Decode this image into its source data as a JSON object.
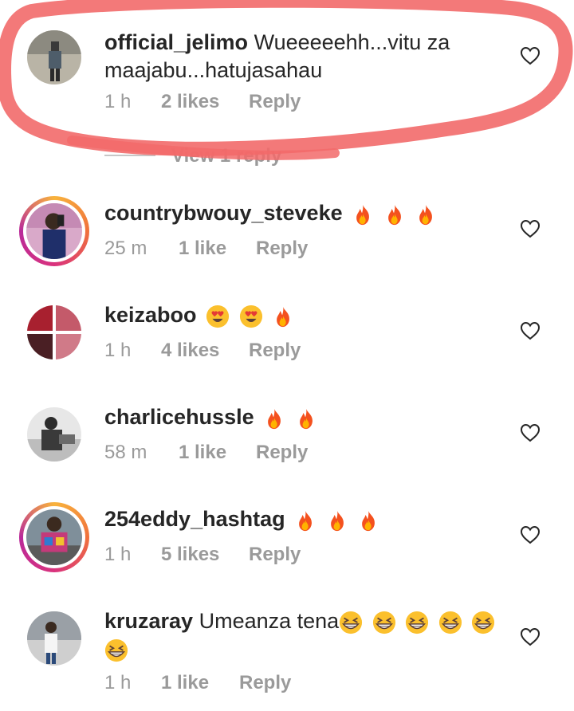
{
  "comments": [
    {
      "username": "official_jelimo",
      "text": "Wueeeeehh...vitu za maajabu...hatujasahau",
      "time": "1 h",
      "likes": "2 likes",
      "reply": "Reply",
      "view_replies": "View 1 reply",
      "emojis": []
    },
    {
      "username": "countrybwouy_steveke",
      "text": "",
      "time": "25 m",
      "likes": "1 like",
      "reply": "Reply",
      "emojis": [
        "fire",
        "fire",
        "fire"
      ]
    },
    {
      "username": "keizaboo",
      "text": "",
      "time": "1 h",
      "likes": "4 likes",
      "reply": "Reply",
      "emojis": [
        "heart-eyes",
        "heart-eyes",
        "fire"
      ]
    },
    {
      "username": "charlicehussle",
      "text": "",
      "time": "58 m",
      "likes": "1 like",
      "reply": "Reply",
      "emojis": [
        "fire",
        "fire"
      ]
    },
    {
      "username": "254eddy_hashtag",
      "text": "",
      "time": "1 h",
      "likes": "5 likes",
      "reply": "Reply",
      "emojis": [
        "fire",
        "fire",
        "fire"
      ]
    },
    {
      "username": "kruzaray",
      "text": "Umeanza tena",
      "time": "1 h",
      "likes": "1 like",
      "reply": "Reply",
      "emojis": [
        "grin",
        "grin",
        "grin",
        "grin",
        "grin",
        "grin"
      ]
    }
  ],
  "colors": {
    "highlight": "#f26a6a",
    "story_ring": "#d9327d",
    "secondary_text": "#9a9a9a"
  },
  "icons": {
    "like": "heart-outline-icon",
    "fire": "fire-emoji",
    "heart_eyes": "heart-eyes-emoji",
    "grin": "grinning-squint-emoji"
  }
}
